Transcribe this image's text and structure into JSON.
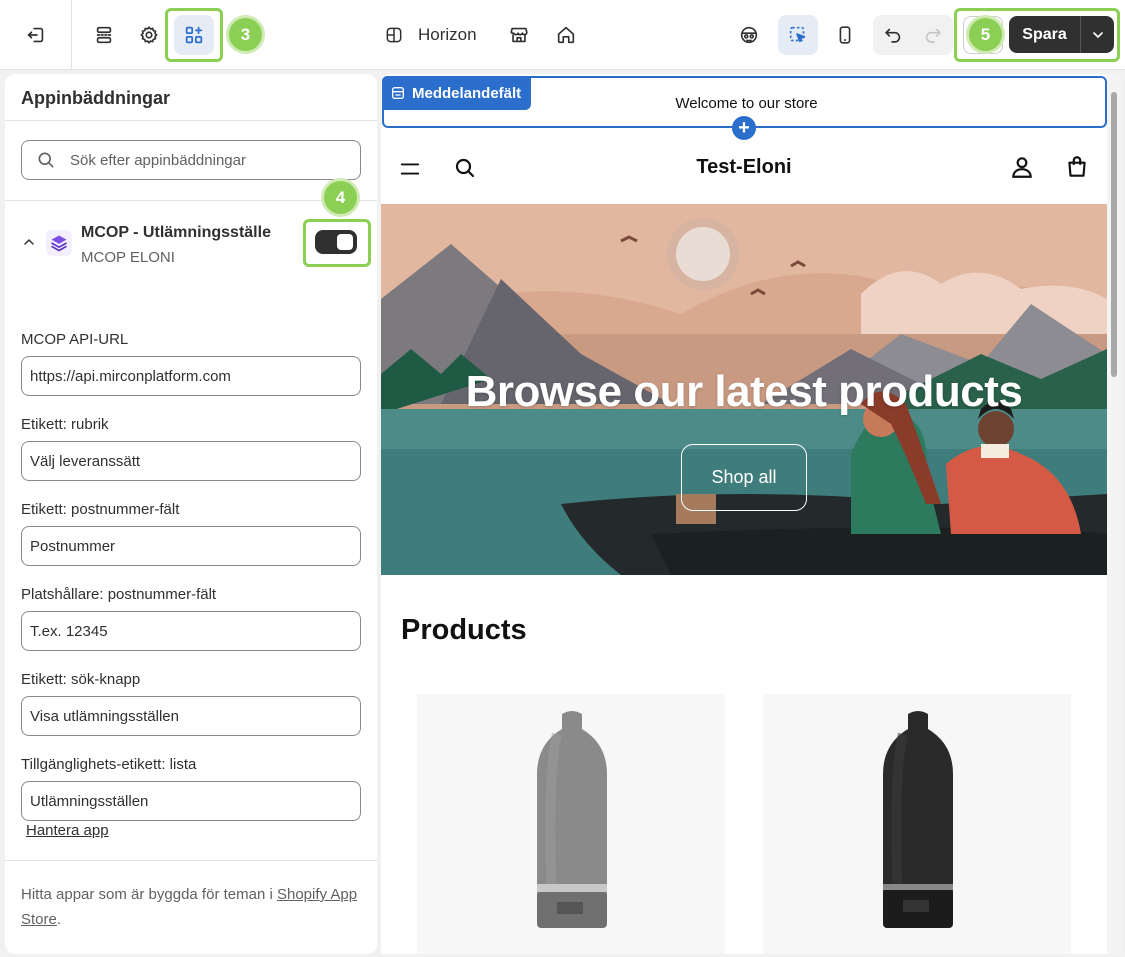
{
  "topbar": {
    "theme_name": "Horizon",
    "save_label": "Spara",
    "markers": [
      "3",
      "5"
    ]
  },
  "panel": {
    "title": "Appinbäddningar",
    "search_placeholder": "Sök efter appinbäddningar",
    "marker": "4",
    "app": {
      "name": "MCOP - Utlämningsställe",
      "vendor": "MCOP ELONI",
      "enabled": true
    },
    "fields": [
      {
        "label": "MCOP API-URL",
        "value": "https://api.mirconplatform.com"
      },
      {
        "label": "Etikett: rubrik",
        "value": "Välj leveranssätt"
      },
      {
        "label": "Etikett: postnummer-fält",
        "value": "Postnummer"
      },
      {
        "label": "Platshållare: postnummer-fält",
        "value": "T.ex. 12345"
      },
      {
        "label": "Etikett: sök-knapp",
        "value": "Visa utlämningsställen"
      },
      {
        "label": "Tillgänglighets-etikett: lista",
        "value": "Utlämningsställen"
      }
    ],
    "manage_link": "Hantera app",
    "footer_text": "Hitta appar som är byggda för teman i ",
    "footer_link": "Shopify App Store",
    "footer_end": "."
  },
  "preview": {
    "section_tag": "Meddelandefält",
    "announcement": "Welcome to our store",
    "store_name": "Test-Eloni",
    "hero_title": "Browse our latest products",
    "hero_button": "Shop all",
    "products_heading": "Products"
  },
  "colors": {
    "accent": "#2c6ecb",
    "highlight": "#8ccf55",
    "dark": "#303030"
  }
}
